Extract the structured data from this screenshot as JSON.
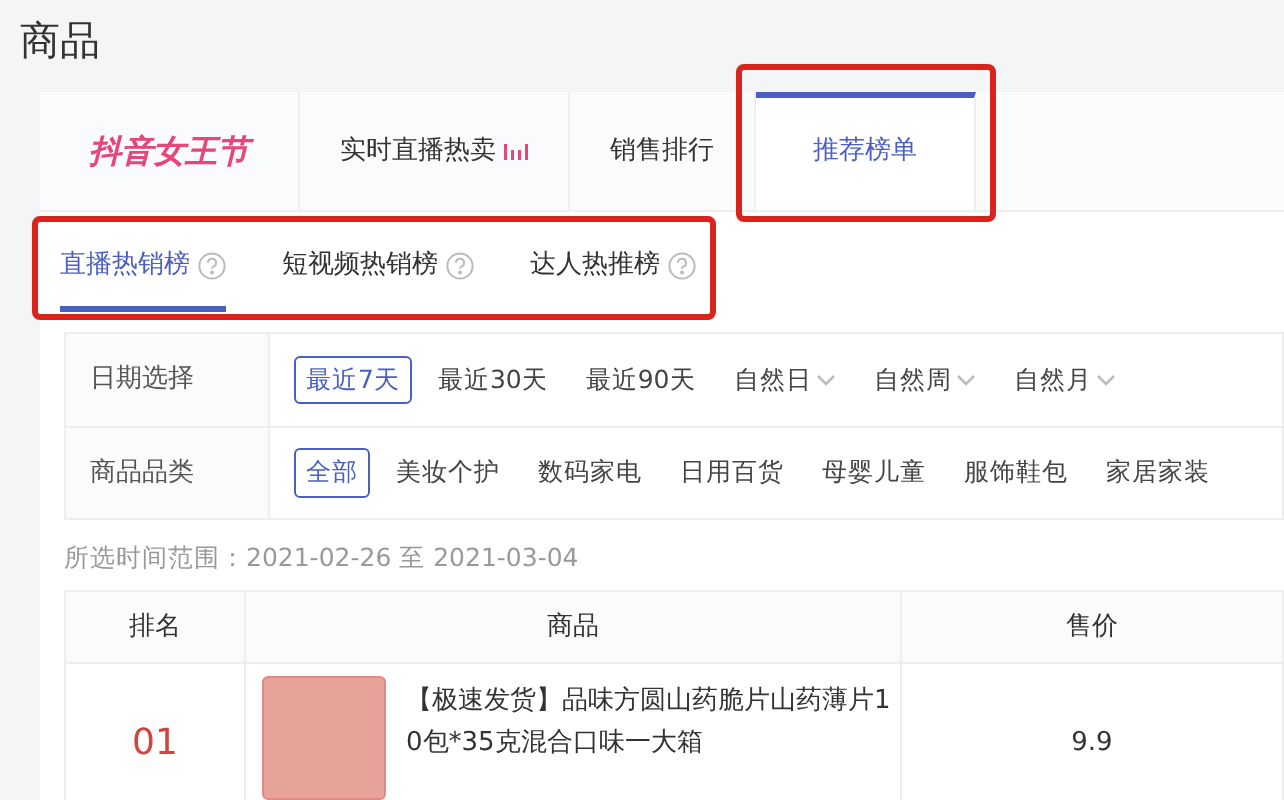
{
  "page_title": "商品",
  "brand": {
    "logo_text": "抖音女王节"
  },
  "main_tabs": [
    {
      "label": "实时直播热卖",
      "live": true,
      "selected": false,
      "highlighted": false
    },
    {
      "label": "销售排行",
      "live": false,
      "selected": false,
      "highlighted": false
    },
    {
      "label": "推荐榜单",
      "live": false,
      "selected": true,
      "highlighted": true
    }
  ],
  "sub_tabs": {
    "highlighted": true,
    "items": [
      {
        "label": "直播热销榜",
        "selected": true
      },
      {
        "label": "短视频热销榜",
        "selected": false
      },
      {
        "label": "达人热推榜",
        "selected": false
      }
    ]
  },
  "filters": [
    {
      "label": "日期选择",
      "options": [
        {
          "label": "最近7天",
          "selected": true,
          "dropdown": false
        },
        {
          "label": "最近30天",
          "selected": false,
          "dropdown": false
        },
        {
          "label": "最近90天",
          "selected": false,
          "dropdown": false
        },
        {
          "label": "自然日",
          "selected": false,
          "dropdown": true
        },
        {
          "label": "自然周",
          "selected": false,
          "dropdown": true
        },
        {
          "label": "自然月",
          "selected": false,
          "dropdown": true
        }
      ]
    },
    {
      "label": "商品品类",
      "options": [
        {
          "label": "全部",
          "selected": true,
          "dropdown": false
        },
        {
          "label": "美妆个护",
          "selected": false,
          "dropdown": false
        },
        {
          "label": "数码家电",
          "selected": false,
          "dropdown": false
        },
        {
          "label": "日用百货",
          "selected": false,
          "dropdown": false
        },
        {
          "label": "母婴儿童",
          "selected": false,
          "dropdown": false
        },
        {
          "label": "服饰鞋包",
          "selected": false,
          "dropdown": false
        },
        {
          "label": "家居家装",
          "selected": false,
          "dropdown": false
        }
      ]
    }
  ],
  "range_text": "所选时间范围：2021-02-26 至 2021-03-04",
  "table": {
    "columns": [
      "排名",
      "商品",
      "售价"
    ],
    "rows": [
      {
        "rank": "01",
        "product": "【极速发货】品味方圆山药脆片山药薄片10包*35克混合口味一大箱",
        "price": "9.9"
      }
    ]
  }
}
